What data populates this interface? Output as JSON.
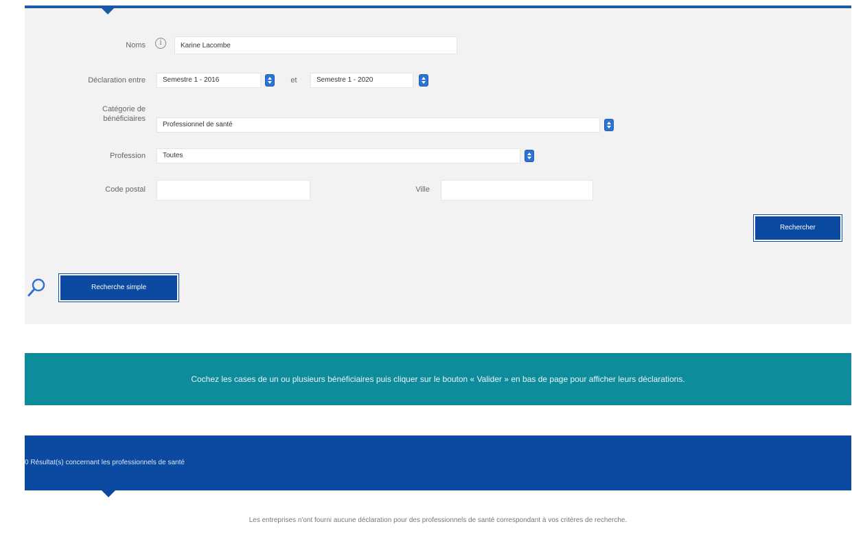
{
  "form": {
    "nom": {
      "label": "Noms",
      "value": "Karine Lacombe"
    },
    "declaration": {
      "label": "Déclaration entre",
      "from": "Semestre 1 - 2016",
      "separator": "et",
      "to": "Semestre 1 - 2020"
    },
    "categorie": {
      "label_line1": "Catégorie de",
      "label_line2": "bénéficiaires",
      "value": "Professionnel de santé"
    },
    "profession": {
      "label": "Profession",
      "value": "Toutes"
    },
    "code_postal": {
      "label": "Code postal",
      "value": ""
    },
    "ville": {
      "label": "Ville",
      "value": ""
    },
    "search_button": "Rechercher",
    "simple_search_button": "Recherche simple"
  },
  "info_band": {
    "text": "Cochez les cases de un ou plusieurs bénéficiaires puis cliquer sur le bouton « Valider » en bas de page pour afficher leurs déclarations."
  },
  "results": {
    "header": "0 Résultat(s) concernant les professionnels de santé",
    "empty_message": "Les entreprises n'ont fourni aucune déclaration pour des professionnels de santé correspondant à vos critères de recherche."
  },
  "colors": {
    "primary": "#0b4aa0",
    "info_band": "#0f8c9c",
    "panel": "#f2f2f2"
  }
}
